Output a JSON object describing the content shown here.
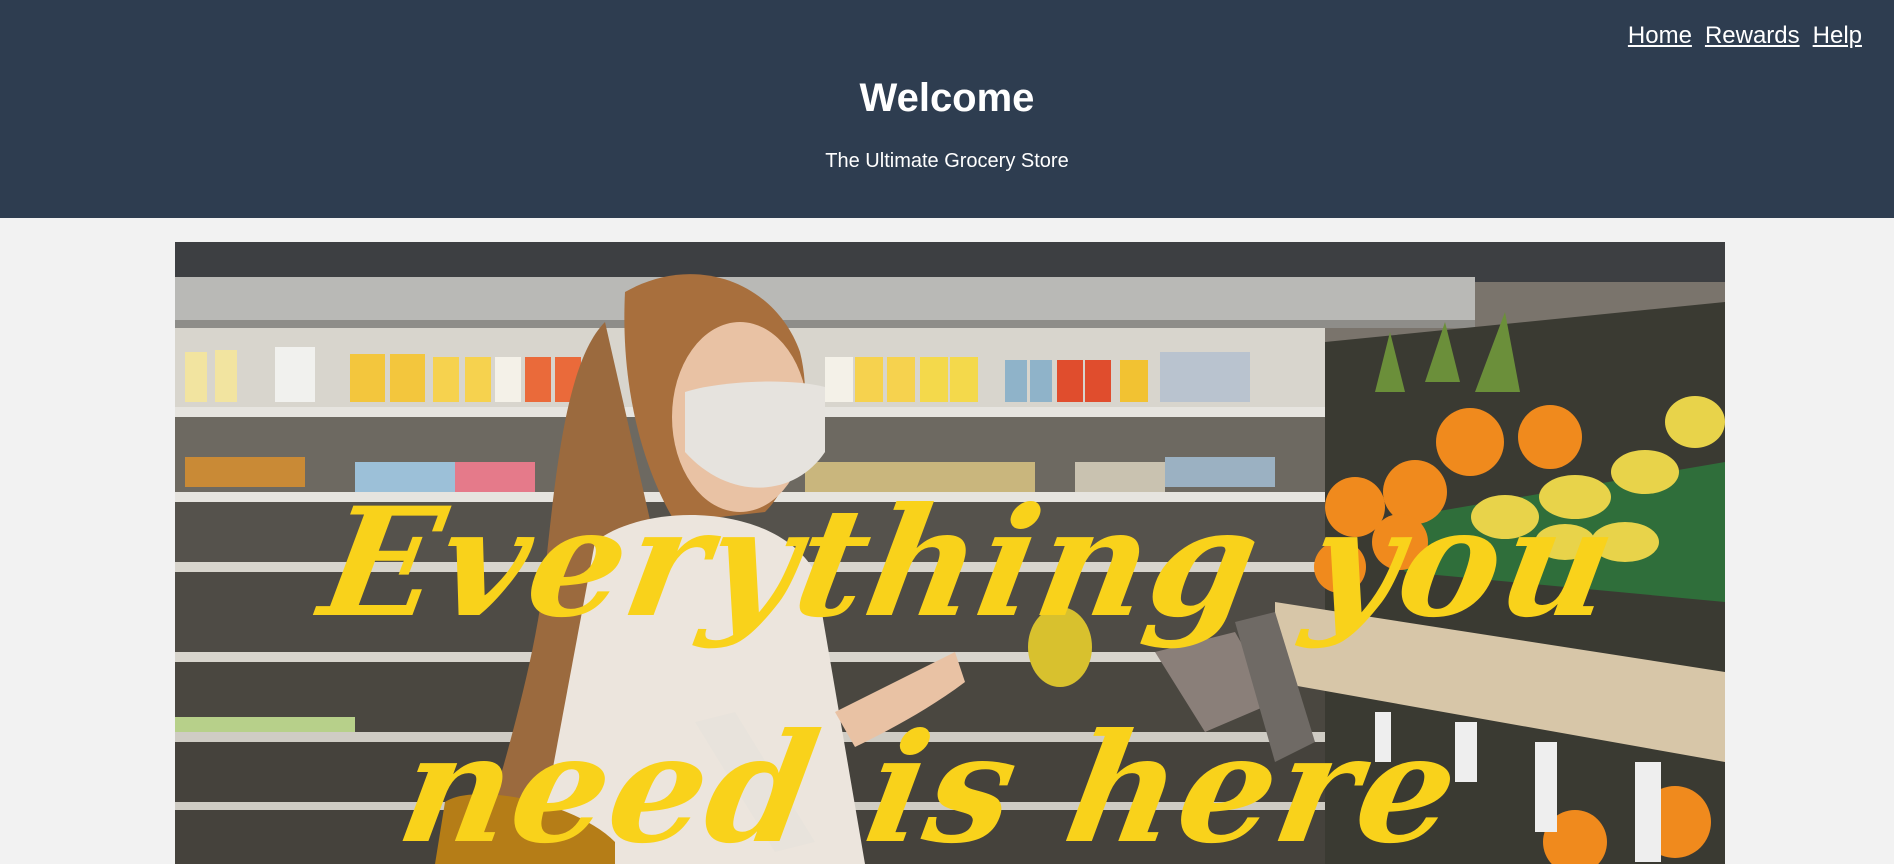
{
  "nav": {
    "links": [
      "Home",
      "Rewards",
      "Help"
    ]
  },
  "header": {
    "title": "Welcome",
    "subtitle": "The Ultimate Grocery Store"
  },
  "hero": {
    "tagline": "Everything you need is here",
    "image_description": "woman-in-mask-holding-lemon-in-grocery-store",
    "tagline_color": "#f9d21b"
  },
  "colors": {
    "header_bg": "#2e3d50",
    "page_bg": "#f2f2f2"
  }
}
